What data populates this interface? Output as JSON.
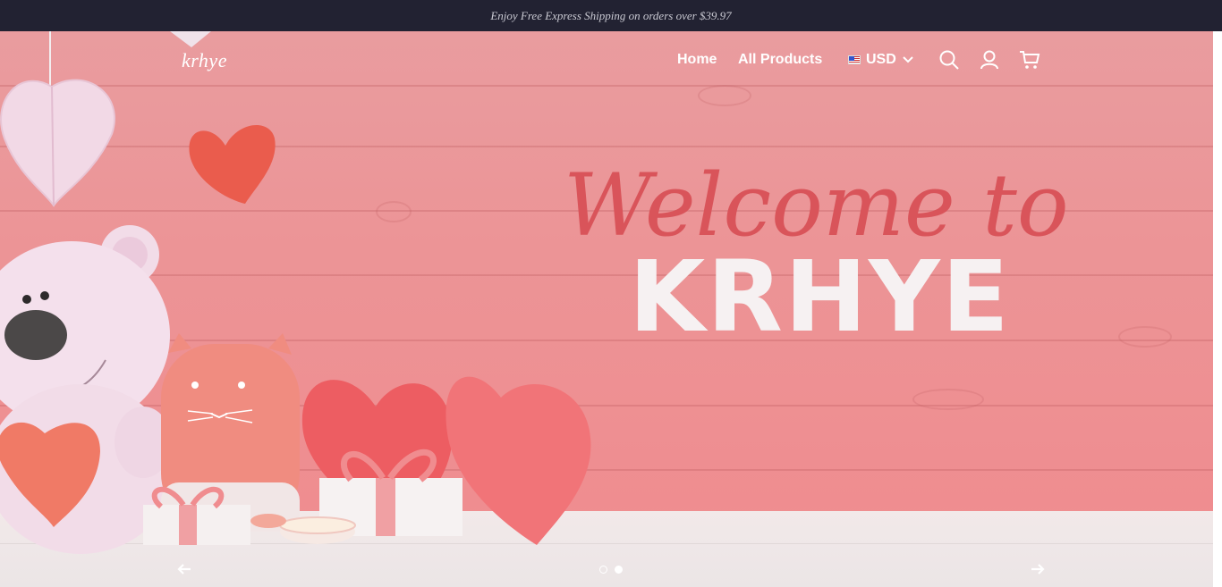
{
  "announcement": {
    "text": "Enjoy Free Express Shipping on orders over $39.97"
  },
  "header": {
    "logo": "krhye",
    "nav": [
      {
        "label": "Home"
      },
      {
        "label": "All Products"
      }
    ],
    "currency": {
      "code": "USD",
      "flag": "us-flag-icon"
    },
    "icons": [
      "search-icon",
      "account-icon",
      "cart-icon"
    ]
  },
  "hero": {
    "script_text": "Welcome to",
    "brand_text": "KRHYE",
    "slides": {
      "count": 2,
      "active_index": 1
    }
  },
  "colors": {
    "announcement_bg": "#222232",
    "hero_pink": "#ec9496",
    "script_red": "#d9545a",
    "brand_white": "#f6f1f2"
  }
}
